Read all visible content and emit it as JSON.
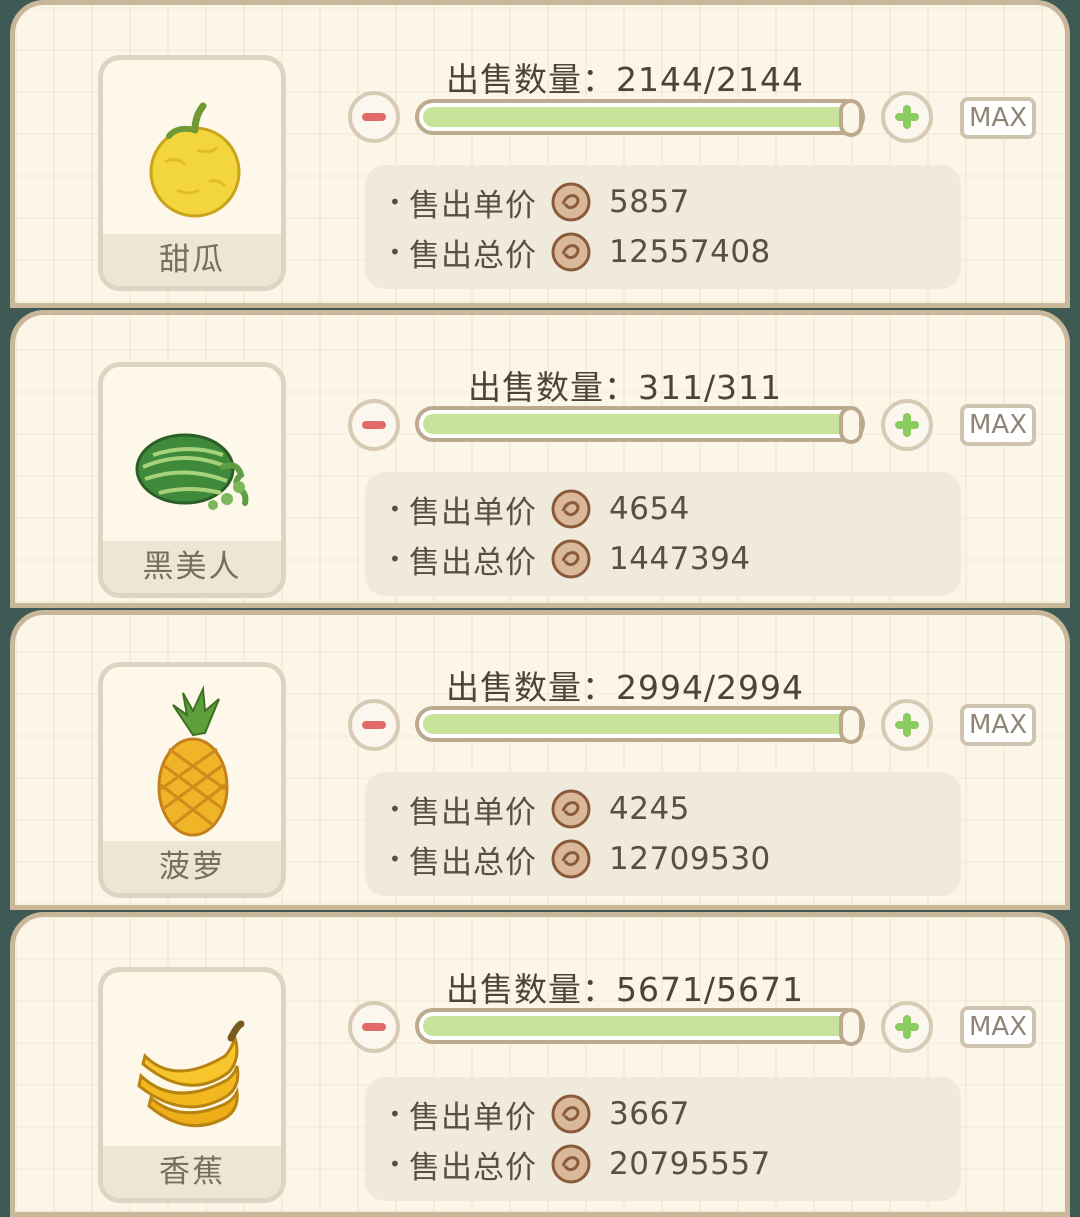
{
  "labels": {
    "qty_prefix": "出售数量：",
    "unit_price": "售出单价",
    "total_price": "售出总价",
    "max": "MAX",
    "bullet": "•"
  },
  "items": [
    {
      "name": "甜瓜",
      "icon": "melon-icon",
      "quantity": "2144/2144",
      "fill_fraction": 1.0,
      "unit_price": "5857",
      "total_price": "12557408"
    },
    {
      "name": "黑美人",
      "icon": "watermelon-icon",
      "quantity": "311/311",
      "fill_fraction": 1.0,
      "unit_price": "4654",
      "total_price": "1447394"
    },
    {
      "name": "菠萝",
      "icon": "pineapple-icon",
      "quantity": "2994/2994",
      "fill_fraction": 1.0,
      "unit_price": "4245",
      "total_price": "12709530"
    },
    {
      "name": "香蕉",
      "icon": "banana-icon",
      "quantity": "5671/5671",
      "fill_fraction": 1.0,
      "unit_price": "3667",
      "total_price": "20795557"
    }
  ],
  "colors": {
    "panel_bg": "#fbf6e7",
    "slider_fill": "#c8e49a",
    "minus_red": "#e46a6a",
    "plus_green": "#8ccb5f",
    "coin_brown": "#8a5a3a"
  }
}
